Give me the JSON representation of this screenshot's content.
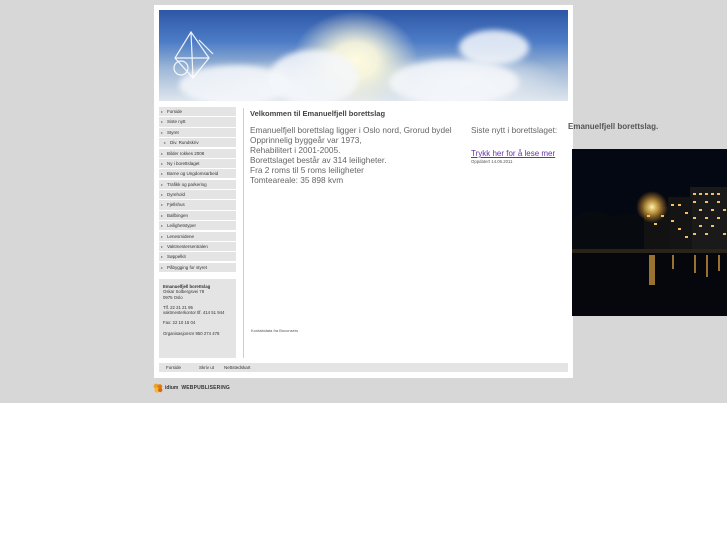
{
  "main": {
    "title": "Velkommen til Emanuelfjell borettslag",
    "body_lines": [
      "Emanuelfjell borettslag ligger i Oslo nord, Grorud bydel",
      "Opprinnelig byggeår var 1973,",
      "Rehabilitert i 2001-2005.",
      "Borettslaget består av 314 leiligheter.",
      "Fra 2 roms til 5 roms leiligheter",
      "Tomteareale: 35 898 kvm"
    ],
    "footnote": "Kontaktdata fra Boconsers"
  },
  "sidebar": {
    "items": [
      {
        "label": "Forside",
        "sub": false
      },
      {
        "label": "Siste nytt",
        "sub": false
      },
      {
        "label": "Styret",
        "sub": false
      },
      {
        "label": "Div. Rundskriv",
        "sub": true
      },
      {
        "label": "Bilder rokkes 2008",
        "sub": false
      },
      {
        "label": "Ny i borettslaget",
        "sub": false
      },
      {
        "label": "Barne og Ungdomsarbeid",
        "sub": false
      },
      {
        "label": "Trafikk og parkering",
        "sub": false
      },
      {
        "label": "Dyrehold",
        "sub": false
      },
      {
        "label": "Fjellshus",
        "sub": false
      },
      {
        "label": "Ballbingen",
        "sub": false
      },
      {
        "label": "Leilighetstyper",
        "sub": false
      },
      {
        "label": "Lenesmidene",
        "sub": false
      },
      {
        "label": "Vaktmestersentralen",
        "sub": false
      },
      {
        "label": "Søppelkit",
        "sub": false
      },
      {
        "label": "Påbygging for styret",
        "sub": false
      }
    ]
  },
  "contact": {
    "name": "Emanuelfjell borettslag",
    "address1": "Oskar Solbergsvei 78",
    "address2": "0975 Oslo",
    "phone": "Tlf. 22 21 21 95",
    "mobile": "vaktmesterkontor tlf. 414 51 944",
    "fax": "Fax: 22 10 15 04",
    "org": "Organisasjonsnr 950 274 478"
  },
  "news": {
    "heading": "Siste nytt i borettslaget:",
    "link": "Trykk her for å lese mer",
    "updated": "Oppdatert 14.06.2011"
  },
  "footer": {
    "links": [
      "Forside",
      "Skriv ut",
      "Nettstedskart"
    ]
  },
  "brand": {
    "name": "idium",
    "tagline": "WEBPUBLISERING"
  },
  "right_panel": {
    "title": "Emanuelfjell borettslag."
  },
  "colors": {
    "background": "#d7d7d7",
    "link": "#6633aa",
    "sidebar_item": "#e4e4e4"
  }
}
